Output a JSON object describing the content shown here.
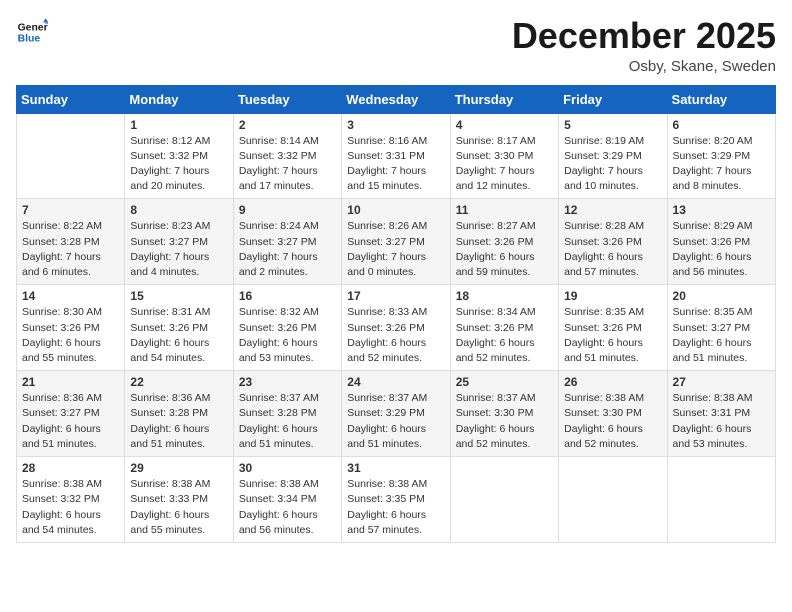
{
  "header": {
    "logo_line1": "General",
    "logo_line2": "Blue",
    "month_title": "December 2025",
    "location": "Osby, Skane, Sweden"
  },
  "weekdays": [
    "Sunday",
    "Monday",
    "Tuesday",
    "Wednesday",
    "Thursday",
    "Friday",
    "Saturday"
  ],
  "weeks": [
    [
      {
        "day": "",
        "info": ""
      },
      {
        "day": "1",
        "info": "Sunrise: 8:12 AM\nSunset: 3:32 PM\nDaylight: 7 hours\nand 20 minutes."
      },
      {
        "day": "2",
        "info": "Sunrise: 8:14 AM\nSunset: 3:32 PM\nDaylight: 7 hours\nand 17 minutes."
      },
      {
        "day": "3",
        "info": "Sunrise: 8:16 AM\nSunset: 3:31 PM\nDaylight: 7 hours\nand 15 minutes."
      },
      {
        "day": "4",
        "info": "Sunrise: 8:17 AM\nSunset: 3:30 PM\nDaylight: 7 hours\nand 12 minutes."
      },
      {
        "day": "5",
        "info": "Sunrise: 8:19 AM\nSunset: 3:29 PM\nDaylight: 7 hours\nand 10 minutes."
      },
      {
        "day": "6",
        "info": "Sunrise: 8:20 AM\nSunset: 3:29 PM\nDaylight: 7 hours\nand 8 minutes."
      }
    ],
    [
      {
        "day": "7",
        "info": "Sunrise: 8:22 AM\nSunset: 3:28 PM\nDaylight: 7 hours\nand 6 minutes."
      },
      {
        "day": "8",
        "info": "Sunrise: 8:23 AM\nSunset: 3:27 PM\nDaylight: 7 hours\nand 4 minutes."
      },
      {
        "day": "9",
        "info": "Sunrise: 8:24 AM\nSunset: 3:27 PM\nDaylight: 7 hours\nand 2 minutes."
      },
      {
        "day": "10",
        "info": "Sunrise: 8:26 AM\nSunset: 3:27 PM\nDaylight: 7 hours\nand 0 minutes."
      },
      {
        "day": "11",
        "info": "Sunrise: 8:27 AM\nSunset: 3:26 PM\nDaylight: 6 hours\nand 59 minutes."
      },
      {
        "day": "12",
        "info": "Sunrise: 8:28 AM\nSunset: 3:26 PM\nDaylight: 6 hours\nand 57 minutes."
      },
      {
        "day": "13",
        "info": "Sunrise: 8:29 AM\nSunset: 3:26 PM\nDaylight: 6 hours\nand 56 minutes."
      }
    ],
    [
      {
        "day": "14",
        "info": "Sunrise: 8:30 AM\nSunset: 3:26 PM\nDaylight: 6 hours\nand 55 minutes."
      },
      {
        "day": "15",
        "info": "Sunrise: 8:31 AM\nSunset: 3:26 PM\nDaylight: 6 hours\nand 54 minutes."
      },
      {
        "day": "16",
        "info": "Sunrise: 8:32 AM\nSunset: 3:26 PM\nDaylight: 6 hours\nand 53 minutes."
      },
      {
        "day": "17",
        "info": "Sunrise: 8:33 AM\nSunset: 3:26 PM\nDaylight: 6 hours\nand 52 minutes."
      },
      {
        "day": "18",
        "info": "Sunrise: 8:34 AM\nSunset: 3:26 PM\nDaylight: 6 hours\nand 52 minutes."
      },
      {
        "day": "19",
        "info": "Sunrise: 8:35 AM\nSunset: 3:26 PM\nDaylight: 6 hours\nand 51 minutes."
      },
      {
        "day": "20",
        "info": "Sunrise: 8:35 AM\nSunset: 3:27 PM\nDaylight: 6 hours\nand 51 minutes."
      }
    ],
    [
      {
        "day": "21",
        "info": "Sunrise: 8:36 AM\nSunset: 3:27 PM\nDaylight: 6 hours\nand 51 minutes."
      },
      {
        "day": "22",
        "info": "Sunrise: 8:36 AM\nSunset: 3:28 PM\nDaylight: 6 hours\nand 51 minutes."
      },
      {
        "day": "23",
        "info": "Sunrise: 8:37 AM\nSunset: 3:28 PM\nDaylight: 6 hours\nand 51 minutes."
      },
      {
        "day": "24",
        "info": "Sunrise: 8:37 AM\nSunset: 3:29 PM\nDaylight: 6 hours\nand 51 minutes."
      },
      {
        "day": "25",
        "info": "Sunrise: 8:37 AM\nSunset: 3:30 PM\nDaylight: 6 hours\nand 52 minutes."
      },
      {
        "day": "26",
        "info": "Sunrise: 8:38 AM\nSunset: 3:30 PM\nDaylight: 6 hours\nand 52 minutes."
      },
      {
        "day": "27",
        "info": "Sunrise: 8:38 AM\nSunset: 3:31 PM\nDaylight: 6 hours\nand 53 minutes."
      }
    ],
    [
      {
        "day": "28",
        "info": "Sunrise: 8:38 AM\nSunset: 3:32 PM\nDaylight: 6 hours\nand 54 minutes."
      },
      {
        "day": "29",
        "info": "Sunrise: 8:38 AM\nSunset: 3:33 PM\nDaylight: 6 hours\nand 55 minutes."
      },
      {
        "day": "30",
        "info": "Sunrise: 8:38 AM\nSunset: 3:34 PM\nDaylight: 6 hours\nand 56 minutes."
      },
      {
        "day": "31",
        "info": "Sunrise: 8:38 AM\nSunset: 3:35 PM\nDaylight: 6 hours\nand 57 minutes."
      },
      {
        "day": "",
        "info": ""
      },
      {
        "day": "",
        "info": ""
      },
      {
        "day": "",
        "info": ""
      }
    ]
  ]
}
